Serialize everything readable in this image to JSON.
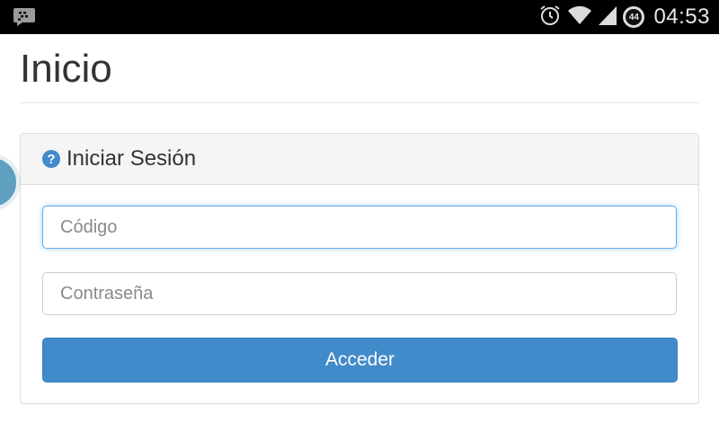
{
  "status_bar": {
    "time": "04:53",
    "battery_level": "44",
    "icons": [
      "bbm-notification-icon",
      "alarm-icon",
      "wifi-icon",
      "signal-icon",
      "battery-icon"
    ]
  },
  "page": {
    "title": "Inicio"
  },
  "login_panel": {
    "title": "Iniciar Sesión",
    "title_icon": "question-circle-icon",
    "code_field": {
      "placeholder": "Código",
      "value": ""
    },
    "password_field": {
      "placeholder": "Contraseña",
      "value": ""
    },
    "submit_label": "Acceder"
  },
  "colors": {
    "status_bar_bg": "#000000",
    "primary": "#428bca",
    "focus_border": "#66afe9",
    "panel_heading_bg": "#f5f5f5"
  }
}
